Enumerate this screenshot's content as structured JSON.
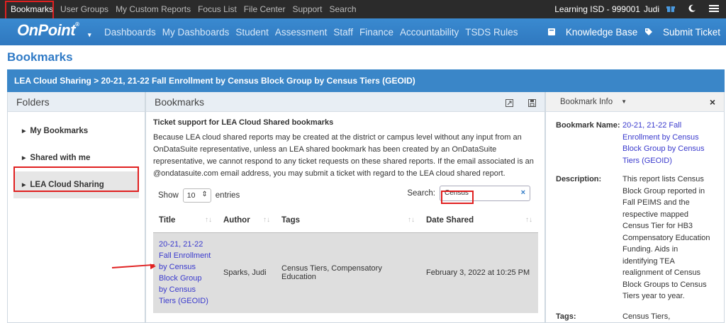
{
  "topbar": {
    "items": [
      "Bookmarks",
      "User Groups",
      "My Custom Reports",
      "Focus List",
      "File Center",
      "Support",
      "Search"
    ],
    "org": "Learning ISD - 999001",
    "user": "Judi"
  },
  "brand": {
    "logo": "OnPoint",
    "nav": [
      "Dashboards",
      "My Dashboards",
      "Student",
      "Assessment",
      "Staff",
      "Finance",
      "Accountability",
      "TSDS Rules"
    ],
    "knowledge_base": "Knowledge Base",
    "submit_ticket": "Submit Ticket"
  },
  "page": {
    "title": "Bookmarks",
    "breadcrumb": "LEA Cloud Sharing > 20-21, 21-22 Fall Enrollment by Census Block Group by Census Tiers (GEOID)"
  },
  "folders": {
    "title": "Folders",
    "items": [
      "My Bookmarks",
      "Shared with me",
      "LEA Cloud Sharing"
    ]
  },
  "bookmarks": {
    "title": "Bookmarks",
    "notice_title": "Ticket support for LEA Cloud Shared bookmarks",
    "notice_body": "Because LEA cloud shared reports may be created at the district or campus level without any input from an OnDataSuite representative, unless an LEA shared bookmark has been created by an OnDataSuite representative, we cannot respond to any ticket requests on these shared reports. If the email associated is an @ondatasuite.com email address, you may submit a ticket with regard to the LEA cloud shared report.",
    "show_label": "Show",
    "entries_value": "10",
    "entries_label": "entries",
    "search_label": "Search:",
    "search_value": "Census",
    "columns": [
      "Title",
      "Author",
      "Tags",
      "Date Shared"
    ],
    "rows": [
      {
        "title": "20-21, 21-22 Fall Enrollment by Census Block Group by Census Tiers (GEOID)",
        "author": "Sparks, Judi",
        "tags": "Census Tiers, Compensatory Education",
        "date": "February 3, 2022 at 10:25 PM"
      }
    ]
  },
  "info": {
    "title": "Bookmark Info",
    "name_label": "Bookmark Name:",
    "name_value": "20-21, 21-22 Fall Enrollment by Census Block Group by Census Tiers (GEOID)",
    "desc_label": "Description:",
    "desc_value": "This report lists Census Block Group reported in Fall PEIMS and the respective mapped Census Tier for HB3 Compensatory Education Funding. Aids in identifying TEA realignment of Census Block Groups to Census Tiers year to year.",
    "tags_label": "Tags:",
    "tags_value": "Census Tiers, Compensatory Education"
  }
}
